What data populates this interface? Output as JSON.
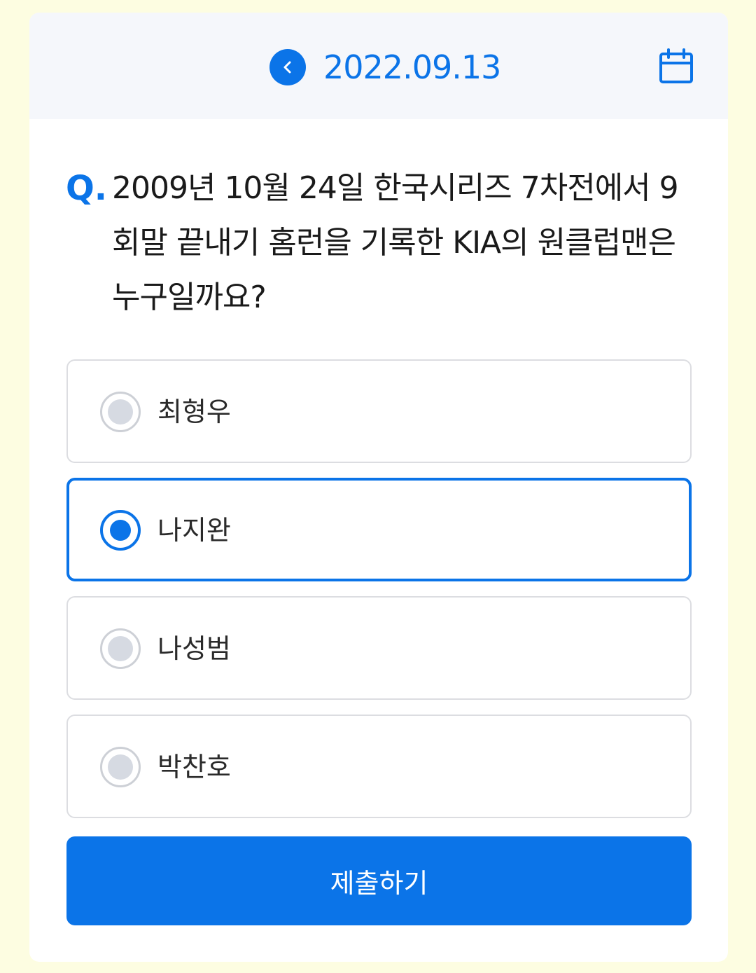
{
  "header": {
    "date": "2022.09.13",
    "back_icon": "chevron-left-icon",
    "calendar_icon": "calendar-icon",
    "accent_color": "#0b74e8"
  },
  "question": {
    "prefix": "Q.",
    "text": "2009년 10월 24일 한국시리즈 7차전에서 9회말 끝내기 홈런을 기록한 KIA의 원클럽맨은 누구일까요?"
  },
  "options": [
    {
      "label": "최형우",
      "selected": false
    },
    {
      "label": "나지완",
      "selected": true
    },
    {
      "label": "나성범",
      "selected": false
    },
    {
      "label": "박찬호",
      "selected": false
    }
  ],
  "submit_label": "제출하기"
}
